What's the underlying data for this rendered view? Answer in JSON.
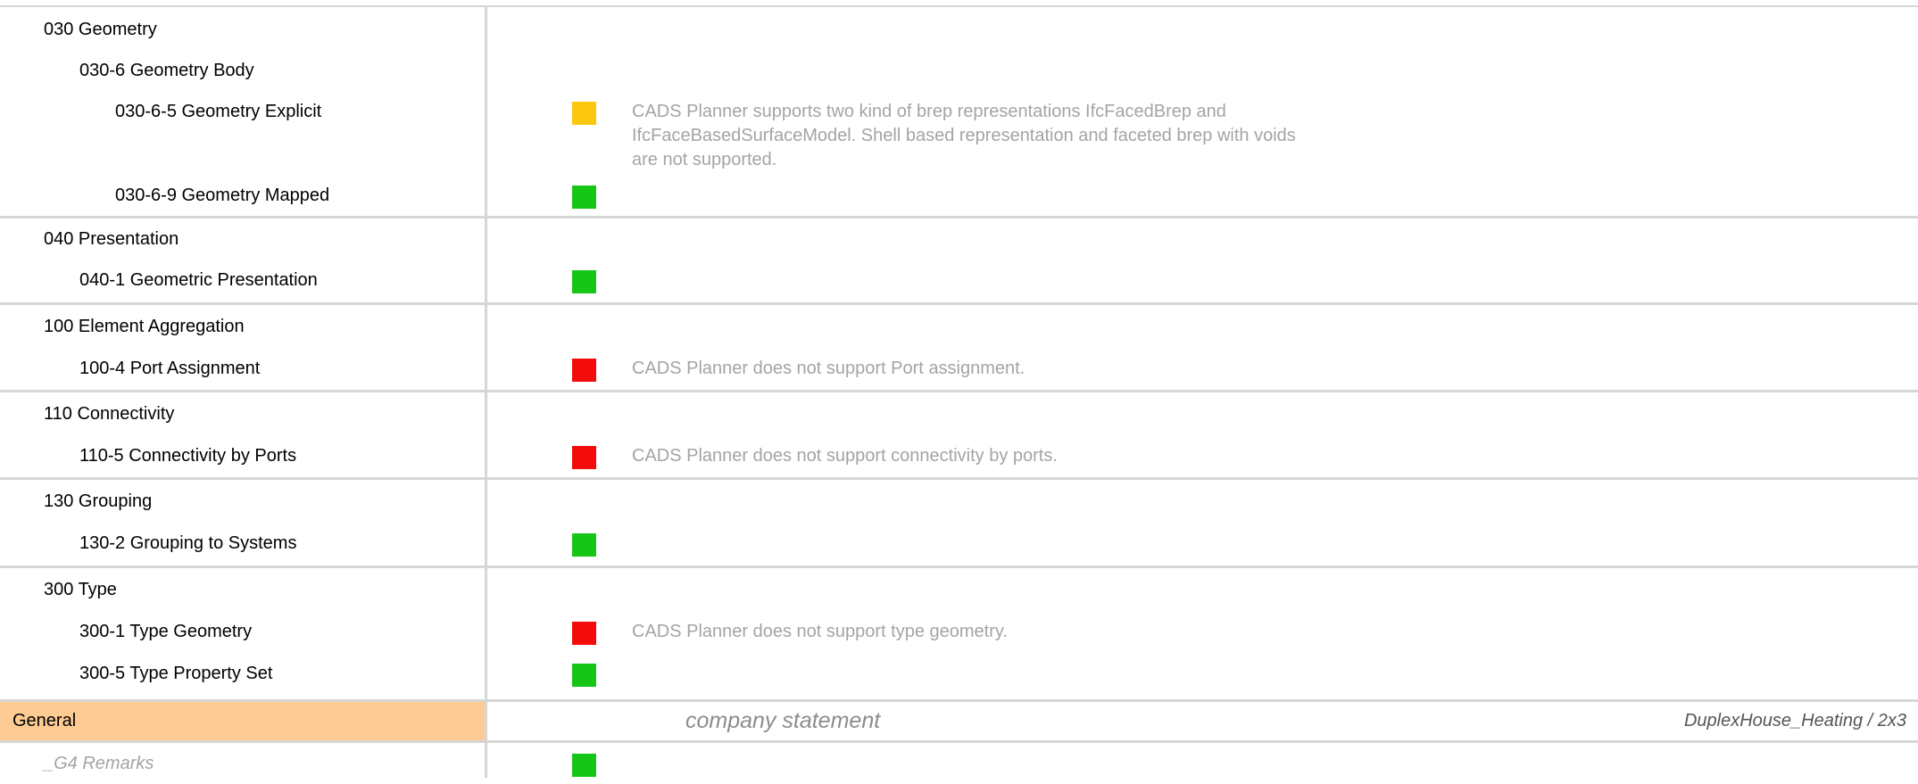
{
  "rows": {
    "r030": {
      "label": "030 Geometry"
    },
    "r030_6": {
      "label": "030-6 Geometry Body"
    },
    "r030_6_5": {
      "label": "030-6-5 Geometry Explicit",
      "status": "partial",
      "note": " CADS Planner supports two kind of brep representations IfcFacedBrep and IfcFaceBasedSurfaceModel. Shell based representation and faceted brep with voids are not supported."
    },
    "r030_6_9": {
      "label": "030-6-9 Geometry Mapped",
      "status": "supported"
    },
    "r040": {
      "label": "040 Presentation"
    },
    "r040_1": {
      "label": "040-1 Geometric Presentation",
      "status": "supported"
    },
    "r100": {
      "label": "100 Element Aggregation"
    },
    "r100_4": {
      "label": "100-4 Port Assignment",
      "status": "unsupported",
      "note": "CADS Planner does not support Port assignment."
    },
    "r110": {
      "label": "110 Connectivity"
    },
    "r110_5": {
      "label": "110-5 Connectivity by Ports",
      "status": "unsupported",
      "note": "CADS Planner does not support connectivity by ports."
    },
    "r130": {
      "label": "130 Grouping"
    },
    "r130_2": {
      "label": "130-2 Grouping to Systems",
      "status": "supported"
    },
    "r300": {
      "label": "300 Type"
    },
    "r300_1": {
      "label": "300-1 Type Geometry",
      "status": "unsupported",
      "note": "CADS Planner does not support type geometry."
    },
    "r300_5": {
      "label": "300-5 Type Property Set",
      "status": "supported"
    }
  },
  "general": {
    "label": "General",
    "company_statement": "company statement",
    "document_ref": "DuplexHouse_Heating / 2x3"
  },
  "remarks": {
    "label": "_G4 Remarks",
    "status": "supported"
  },
  "colors": {
    "supported": "#17c517",
    "unsupported": "#f20c0c",
    "partial": "#fcc80e",
    "general_bg": "#fecb94",
    "note_text": "#a4a4a4",
    "grid_line": "#d6d6d6"
  }
}
